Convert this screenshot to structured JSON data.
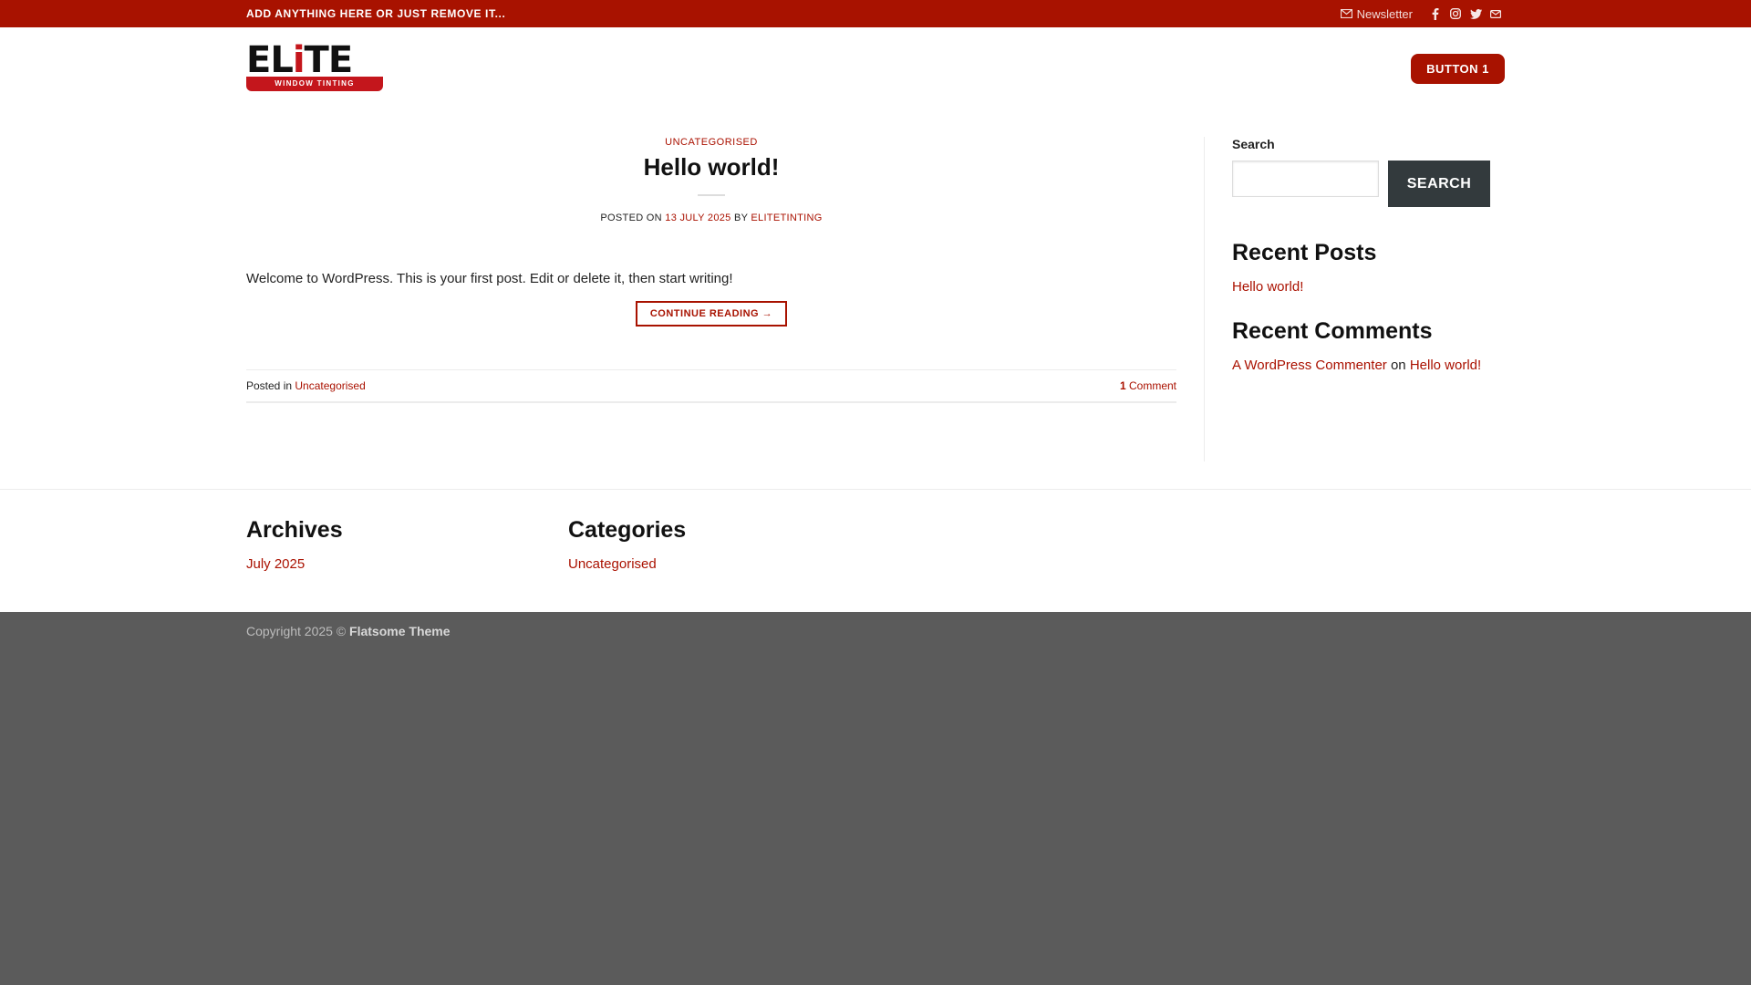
{
  "topbar": {
    "message": "ADD ANYTHING HERE OR JUST REMOVE IT...",
    "newsletter": "Newsletter",
    "icons": [
      "envelope-icon",
      "facebook-icon",
      "instagram-icon",
      "twitter-icon",
      "mail-icon"
    ]
  },
  "header": {
    "logo_word_pre": "EL",
    "logo_word_i": "i",
    "logo_word_post": "TE",
    "logo_tagline": "WINDOW TINTING",
    "button_label": "BUTTON 1"
  },
  "post": {
    "category": "UNCATEGORISED",
    "title": "Hello world!",
    "meta_prefix": "POSTED ON",
    "date": "13 JULY 2025",
    "meta_by": "BY",
    "author": "ELITETINTING",
    "excerpt": "Welcome to WordPress. This is your first post. Edit or delete it, then start writing!",
    "continue_label": "CONTINUE READING →",
    "posted_in_label": "Posted in",
    "posted_in_link": "Uncategorised",
    "comments_count": "1",
    "comments_label": "Comment"
  },
  "sidebar": {
    "search_label": "Search",
    "search_value": "",
    "search_button": "SEARCH",
    "recent_posts_title": "Recent Posts",
    "recent_posts": [
      "Hello world!"
    ],
    "recent_comments_title": "Recent Comments",
    "comment_author": "A WordPress Commenter",
    "comment_on": "on",
    "comment_post": "Hello world!"
  },
  "footer": {
    "archives_title": "Archives",
    "archives": [
      "July 2025"
    ],
    "categories_title": "Categories",
    "categories": [
      "Uncategorised"
    ],
    "copyright_prefix": "Copyright 2025 ©",
    "copyright_brand": "Flatsome Theme"
  },
  "colors": {
    "brand_red": "#a81200",
    "link_red": "#aa1100",
    "footer_bg": "#5b5b5b",
    "search_button_bg": "#333a3d"
  }
}
